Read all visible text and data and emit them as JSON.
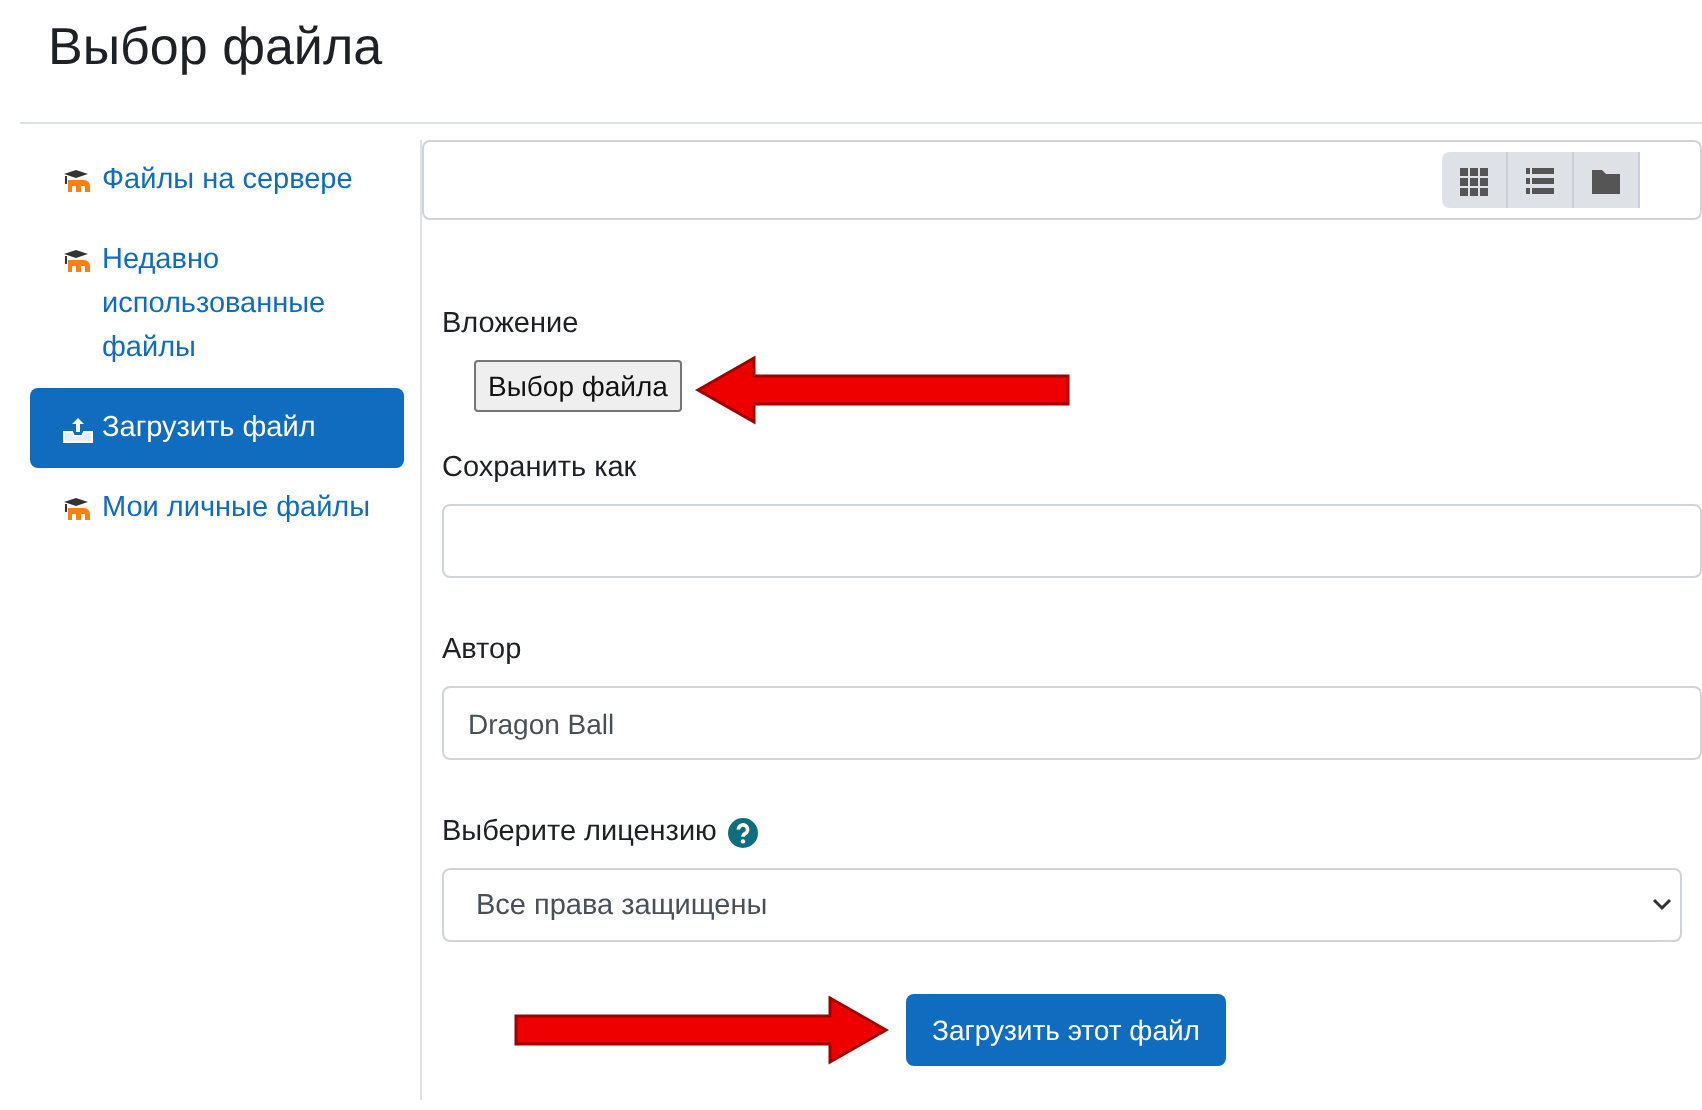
{
  "dialog": {
    "title": "Выбор файла"
  },
  "sidebar": {
    "items": [
      {
        "label": "Файлы на сервере",
        "kind": "repository",
        "selected": false
      },
      {
        "label": "Недавно использованные файлы",
        "kind": "repository",
        "selected": false
      },
      {
        "label": "Загрузить файл",
        "kind": "upload",
        "selected": true
      },
      {
        "label": "Мои личные файлы",
        "kind": "repository",
        "selected": false
      }
    ]
  },
  "toolbar": {
    "views": [
      {
        "kind": "grid"
      },
      {
        "kind": "list"
      },
      {
        "kind": "folder"
      }
    ]
  },
  "form": {
    "attachment": {
      "label": "Вложение",
      "button": "Выбор файла"
    },
    "save_as": {
      "label": "Сохранить как"
    },
    "author": {
      "label": "Автор",
      "value": "Dragon Ball"
    },
    "license": {
      "label": "Выберите лицензию",
      "help": true,
      "value": "Все права защищены"
    },
    "submit": "Загрузить этот файл"
  }
}
